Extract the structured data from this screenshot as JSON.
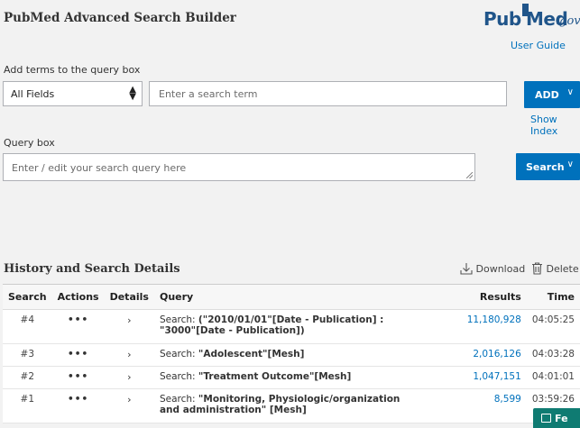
{
  "header": {
    "title": "PubMed Advanced Search Builder",
    "logo": {
      "pub": "Pub",
      "med": "Med",
      "gov": ".gov"
    },
    "user_guide": "User Guide"
  },
  "builder": {
    "label": "Add terms to the query box",
    "field_select": "All Fields",
    "term_placeholder": "Enter a search term",
    "add_button": "ADD",
    "show_index": "Show Index"
  },
  "query_box": {
    "label": "Query box",
    "placeholder": "Enter / edit your search query here",
    "search_button": "Search"
  },
  "history": {
    "title": "History and Search Details",
    "download": "Download",
    "delete": "Delete",
    "columns": [
      "Search",
      "Actions",
      "Details",
      "Query",
      "Results",
      "Time"
    ],
    "rows": [
      {
        "num": "#4",
        "actions": "•••",
        "details": "›",
        "prefix": "Search: ",
        "query": "(\"2010/01/01\"[Date - Publication] : \"3000\"[Date - Publication])",
        "results": "11,180,928",
        "time": "04:05:25"
      },
      {
        "num": "#3",
        "actions": "•••",
        "details": "›",
        "prefix": "Search: ",
        "query": "\"Adolescent\"[Mesh]",
        "results": "2,016,126",
        "time": "04:03:28"
      },
      {
        "num": "#2",
        "actions": "•••",
        "details": "›",
        "prefix": "Search: ",
        "query": "\"Treatment Outcome\"[Mesh]",
        "results": "1,047,151",
        "time": "04:01:01"
      },
      {
        "num": "#1",
        "actions": "•••",
        "details": "›",
        "prefix": "Search: ",
        "query": "\"Monitoring, Physiologic/organization and administration\" [Mesh]",
        "results": "8,599",
        "time": "03:59:26"
      }
    ]
  },
  "feedback": {
    "label": "Fe"
  },
  "colors": {
    "accent": "#0071bc",
    "background": "#f2f2f2",
    "feedback": "#0f7b72"
  }
}
